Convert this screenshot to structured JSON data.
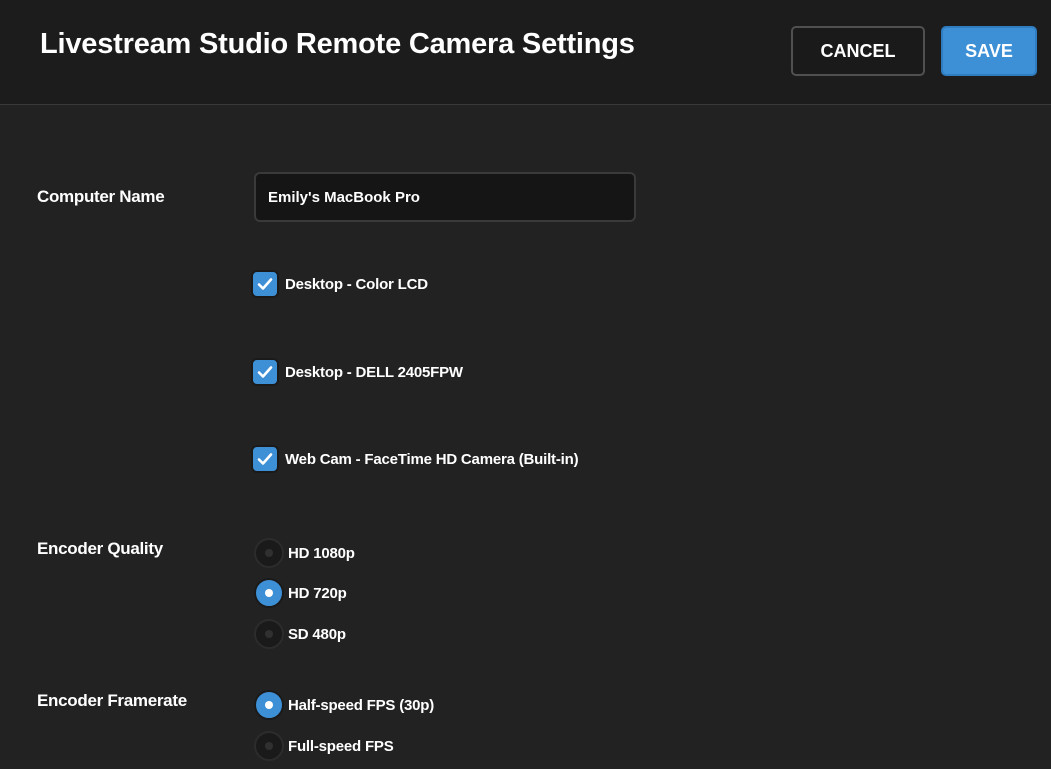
{
  "header": {
    "title": "Livestream Studio Remote Camera Settings",
    "cancel_label": "CANCEL",
    "save_label": "SAVE"
  },
  "computer_name": {
    "label": "Computer Name",
    "value": "Emily's MacBook Pro"
  },
  "sources": [
    {
      "label": "Desktop - Color LCD",
      "checked": true
    },
    {
      "label": "Desktop - DELL 2405FPW",
      "checked": true
    },
    {
      "label": "Web Cam - FaceTime HD Camera (Built-in)",
      "checked": true
    }
  ],
  "encoder_quality": {
    "label": "Encoder Quality",
    "options": [
      {
        "label": "HD 1080p",
        "selected": false
      },
      {
        "label": "HD 720p",
        "selected": true
      },
      {
        "label": "SD 480p",
        "selected": false
      }
    ]
  },
  "encoder_framerate": {
    "label": "Encoder Framerate",
    "options": [
      {
        "label": "Half-speed FPS (30p)",
        "selected": true
      },
      {
        "label": "Full-speed FPS",
        "selected": false
      }
    ]
  },
  "colors": {
    "accent": "#3d8fd6",
    "background": "#222222",
    "header_background": "#1c1c1c"
  }
}
